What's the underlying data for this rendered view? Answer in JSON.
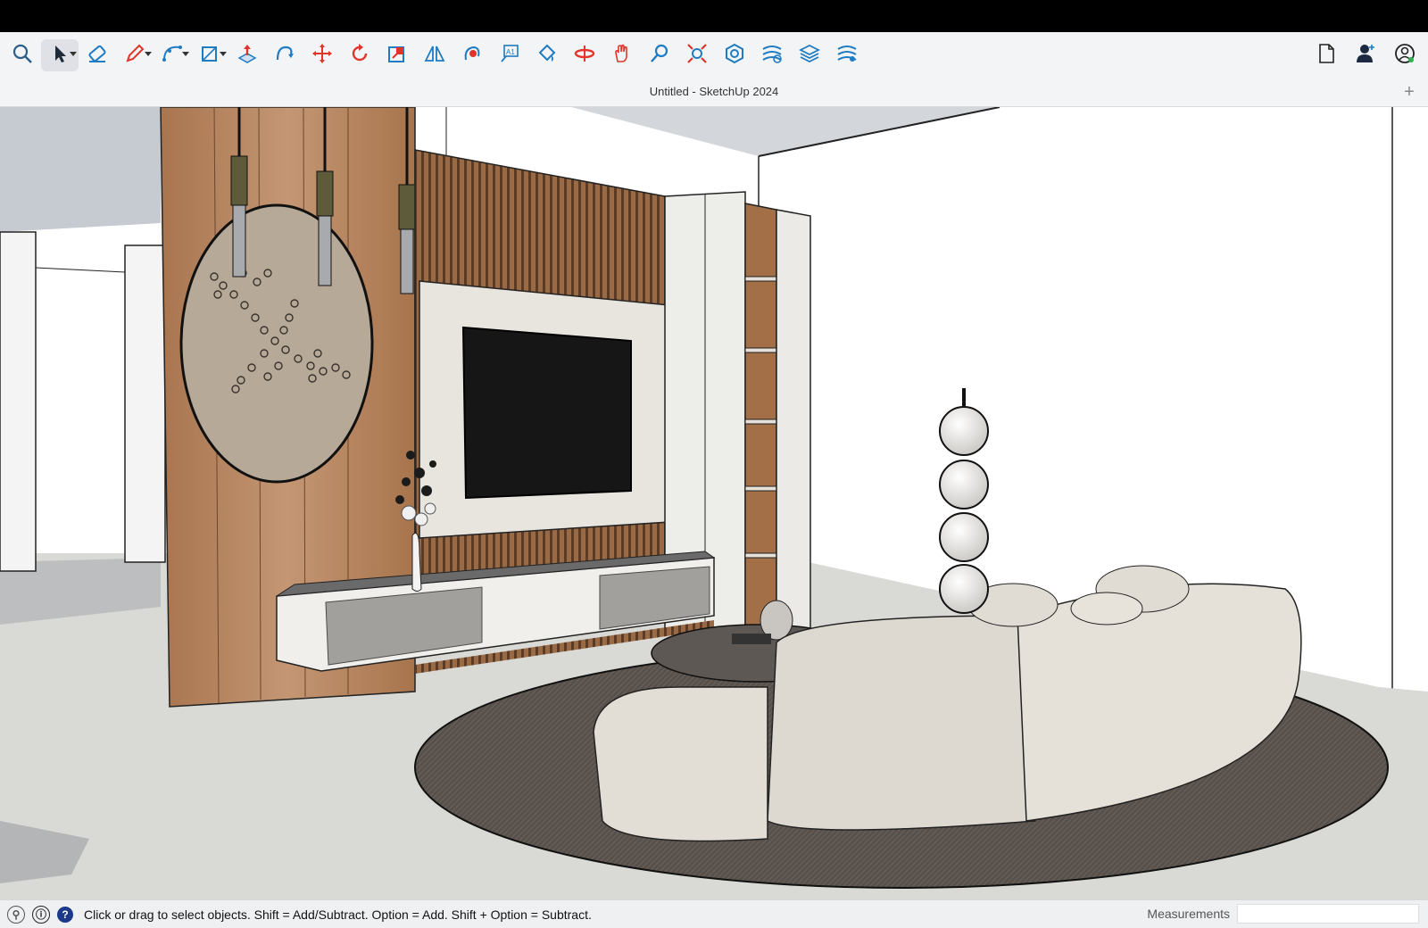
{
  "window": {
    "title": "Untitled - SketchUp 2024",
    "new_tab_label": "+"
  },
  "toolbar": {
    "tools": [
      {
        "name": "search-icon",
        "color": "#2b5f8a"
      },
      {
        "name": "select-tool-icon",
        "color": "#1d2a3a",
        "selected": true,
        "dropdown": true
      },
      {
        "name": "eraser-tool-icon",
        "color": "#1f7bc2"
      },
      {
        "name": "pencil-tool-icon",
        "color": "#e0352b",
        "dropdown": true
      },
      {
        "name": "arc-tool-icon",
        "color": "#1f7bc2",
        "dropdown": true
      },
      {
        "name": "rectangle-tool-icon",
        "color": "#1f7bc2",
        "dropdown": true
      },
      {
        "name": "push-pull-tool-icon",
        "color": "#e0352b"
      },
      {
        "name": "follow-me-tool-icon",
        "color": "#1f7bc2"
      },
      {
        "name": "move-tool-icon",
        "color": "#e0352b"
      },
      {
        "name": "rotate-tool-icon",
        "color": "#e0352b"
      },
      {
        "name": "scale-tool-icon",
        "color": "#e0352b"
      },
      {
        "name": "flip-tool-icon",
        "color": "#1f7bc2"
      },
      {
        "name": "offset-tool-icon",
        "color": "#e0352b"
      },
      {
        "name": "text-tool-icon",
        "color": "#1f7bc2"
      },
      {
        "name": "paint-bucket-tool-icon",
        "color": "#1f7bc2"
      },
      {
        "name": "orbit-tool-icon",
        "color": "#e0352b"
      },
      {
        "name": "pan-tool-icon",
        "color": "#e0352b"
      },
      {
        "name": "zoom-tool-icon",
        "color": "#1f7bc2"
      },
      {
        "name": "zoom-extents-tool-icon",
        "color": "#e0352b"
      },
      {
        "name": "extension-warehouse-icon",
        "color": "#1f7bc2"
      },
      {
        "name": "sandbox-tools-icon",
        "color": "#1f7bc2"
      },
      {
        "name": "layers-tool-icon",
        "color": "#1f7bc2"
      },
      {
        "name": "solid-tools-icon",
        "color": "#1f7bc2"
      }
    ],
    "right_tools": [
      {
        "name": "new-document-icon"
      },
      {
        "name": "account-icon"
      },
      {
        "name": "user-profile-icon"
      }
    ]
  },
  "statusbar": {
    "hint": "Click or drag to select objects. Shift = Add/Subtract. Option = Add. Shift + Option = Subtract.",
    "measurements_label": "Measurements",
    "measurements_value": ""
  },
  "scene": {
    "wall_wood_color": "#b98a63",
    "slat_color": "#8a5e3c",
    "tv_color": "#161616",
    "sofa_color": "#e3ded6",
    "rug_color": "#4e4844",
    "floor_color": "#d9d9d6"
  }
}
